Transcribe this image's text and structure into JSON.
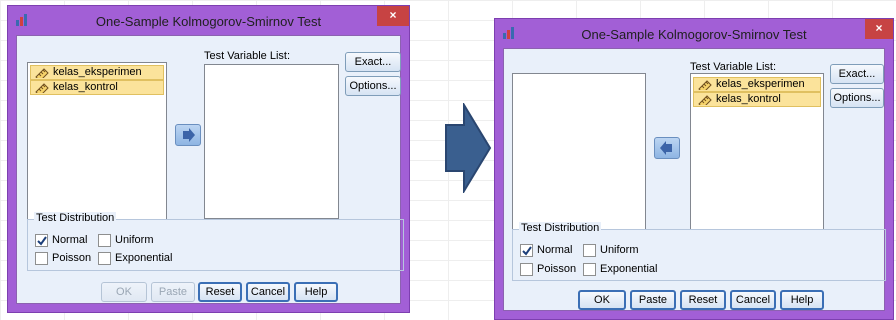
{
  "title": "One-Sample Kolmogorov-Smirnov Test",
  "close_label": "×",
  "test_variable_list_label": "Test Variable List:",
  "variables": [
    "kelas_eksperimen",
    "kelas_kontrol"
  ],
  "buttons": {
    "exact": "Exact...",
    "options": "Options...",
    "ok": "OK",
    "paste": "Paste",
    "reset": "Reset",
    "cancel": "Cancel",
    "help": "Help"
  },
  "test_distribution": {
    "label": "Test Distribution",
    "options": [
      {
        "label": "Normal",
        "checked": true
      },
      {
        "label": "Uniform",
        "checked": false
      },
      {
        "label": "Poisson",
        "checked": false
      },
      {
        "label": "Exponential",
        "checked": false
      }
    ]
  },
  "states": {
    "before": {
      "ok_enabled": false,
      "paste_enabled": false,
      "variables_in": "source"
    },
    "after": {
      "ok_enabled": true,
      "paste_enabled": true,
      "variables_in": "test"
    }
  },
  "colors": {
    "title_bar": "#a25fd6",
    "client": "#e9f0fa",
    "selection": "#fbe39b",
    "close": "#c74343",
    "arrow": "#3a5f8f"
  }
}
